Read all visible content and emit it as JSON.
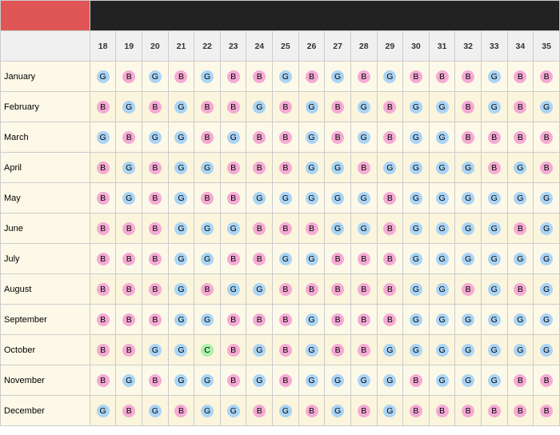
{
  "headers": {
    "top_left_label": "",
    "top_right_label": "",
    "col_numbers": [
      18,
      19,
      20,
      21,
      22,
      23,
      24,
      25,
      26,
      27,
      28,
      29,
      30,
      31,
      32,
      33,
      34,
      35
    ]
  },
  "months": [
    {
      "name": "January",
      "cells": [
        "G",
        "B",
        "G",
        "B",
        "G",
        "B",
        "B",
        "G",
        "B",
        "G",
        "B",
        "G",
        "B",
        "B",
        "B",
        "G",
        "B",
        "B"
      ]
    },
    {
      "name": "February",
      "cells": [
        "B",
        "G",
        "B",
        "G",
        "B",
        "B",
        "G",
        "B",
        "G",
        "B",
        "G",
        "B",
        "G",
        "G",
        "B",
        "G",
        "B",
        "G"
      ]
    },
    {
      "name": "March",
      "cells": [
        "G",
        "B",
        "G",
        "G",
        "B",
        "G",
        "B",
        "B",
        "G",
        "B",
        "G",
        "B",
        "G",
        "G",
        "B",
        "B",
        "B",
        "B"
      ]
    },
    {
      "name": "April",
      "cells": [
        "B",
        "G",
        "B",
        "G",
        "G",
        "B",
        "B",
        "B",
        "G",
        "G",
        "B",
        "G",
        "G",
        "G",
        "G",
        "B",
        "G",
        "B"
      ]
    },
    {
      "name": "May",
      "cells": [
        "B",
        "G",
        "B",
        "G",
        "B",
        "B",
        "G",
        "G",
        "G",
        "G",
        "G",
        "B",
        "G",
        "G",
        "G",
        "G",
        "G",
        "G"
      ]
    },
    {
      "name": "June",
      "cells": [
        "B",
        "B",
        "B",
        "G",
        "G",
        "G",
        "B",
        "B",
        "B",
        "G",
        "G",
        "B",
        "G",
        "G",
        "G",
        "G",
        "B",
        "G"
      ]
    },
    {
      "name": "July",
      "cells": [
        "B",
        "B",
        "B",
        "G",
        "G",
        "B",
        "B",
        "G",
        "G",
        "B",
        "B",
        "B",
        "G",
        "G",
        "G",
        "G",
        "G",
        "G"
      ]
    },
    {
      "name": "August",
      "cells": [
        "B",
        "B",
        "B",
        "G",
        "B",
        "G",
        "G",
        "B",
        "B",
        "B",
        "B",
        "B",
        "G",
        "G",
        "B",
        "G",
        "B",
        "G"
      ]
    },
    {
      "name": "September",
      "cells": [
        "B",
        "B",
        "B",
        "G",
        "G",
        "B",
        "B",
        "B",
        "G",
        "B",
        "B",
        "B",
        "G",
        "G",
        "G",
        "G",
        "G",
        "G"
      ]
    },
    {
      "name": "October",
      "cells": [
        "B",
        "B",
        "G",
        "G",
        "C",
        "B",
        "G",
        "B",
        "G",
        "B",
        "B",
        "G",
        "G",
        "G",
        "G",
        "G",
        "G",
        "G"
      ]
    },
    {
      "name": "November",
      "cells": [
        "B",
        "G",
        "B",
        "G",
        "G",
        "B",
        "G",
        "B",
        "G",
        "G",
        "G",
        "G",
        "B",
        "G",
        "G",
        "G",
        "B",
        "B"
      ]
    },
    {
      "name": "December",
      "cells": [
        "G",
        "B",
        "G",
        "B",
        "G",
        "G",
        "B",
        "G",
        "B",
        "G",
        "B",
        "G",
        "B",
        "B",
        "B",
        "B",
        "B",
        "B"
      ]
    }
  ]
}
